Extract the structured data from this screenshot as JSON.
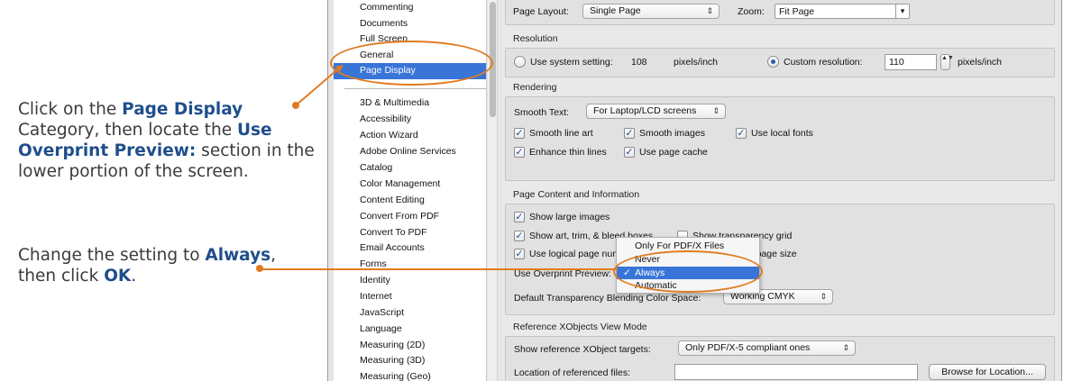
{
  "instructions": {
    "p1_pre1": "Click on the ",
    "p1_b1": "Page Display",
    "p1_mid": " Category, then locate the ",
    "p1_b2": "Use Overprint Preview:",
    "p1_post": " section in the lower portion of the screen.",
    "p2_pre": "Change the setting to ",
    "p2_b1": "Always",
    "p2_mid": ", then click ",
    "p2_b2": "OK",
    "p2_post": "."
  },
  "categories_top": [
    "Commenting",
    "Documents",
    "Full Screen",
    "General",
    "Page Display"
  ],
  "categories_bottom": [
    "3D & Multimedia",
    "Accessibility",
    "Action Wizard",
    "Adobe Online Services",
    "Catalog",
    "Color Management",
    "Content Editing",
    "Convert From PDF",
    "Convert To PDF",
    "Email Accounts",
    "Forms",
    "Identity",
    "Internet",
    "JavaScript",
    "Language",
    "Measuring (2D)",
    "Measuring (3D)",
    "Measuring (Geo)"
  ],
  "layout_row": {
    "page_layout_label": "Page Layout:",
    "page_layout_value": "Single Page",
    "zoom_label": "Zoom:",
    "zoom_value": "Fit Page"
  },
  "resolution": {
    "title": "Resolution",
    "system_label": "Use system setting:",
    "system_value": "108",
    "system_unit": "pixels/inch",
    "custom_label": "Custom resolution:",
    "custom_value": "110",
    "custom_unit": "pixels/inch"
  },
  "rendering": {
    "title": "Rendering",
    "smooth_text_label": "Smooth Text:",
    "smooth_text_value": "For Laptop/LCD screens",
    "smooth_line_art": "Smooth line art",
    "smooth_images": "Smooth images",
    "use_local_fonts": "Use local fonts",
    "enhance_thin_lines": "Enhance thin lines",
    "use_page_cache": "Use page cache"
  },
  "page_content": {
    "title": "Page Content and Information",
    "show_large_images": "Show large images",
    "show_art_boxes": "Show art, trim, & bleed boxes",
    "show_transparency_grid": "Show transparency grid",
    "use_logical_page": "Use logical page numbers",
    "use_document_page_size": "Use document page size",
    "overprint_label": "Use Overprint Preview:",
    "transparency_label": "Default Transparency Blending Color Space:",
    "transparency_value": "Working CMYK"
  },
  "overprint_menu": {
    "options": [
      "Only For PDF/X Files",
      "Never",
      "Always",
      "Automatic"
    ],
    "selected": "Always",
    "check_glyph": "✓"
  },
  "reference": {
    "title": "Reference XObjects View Mode",
    "targets_label": "Show reference XObject targets:",
    "targets_value": "Only PDF/X-5 compliant ones",
    "location_label": "Location of referenced files:",
    "browse_label": "Browse for Location..."
  },
  "colors": {
    "accent_orange": "#e07b20",
    "selection_blue": "#3875d7",
    "instruction_bold": "#1f4e8c"
  },
  "icons": {
    "popup_arrow": "⇕",
    "stepper": "▲▼",
    "dropdown": "▾"
  }
}
